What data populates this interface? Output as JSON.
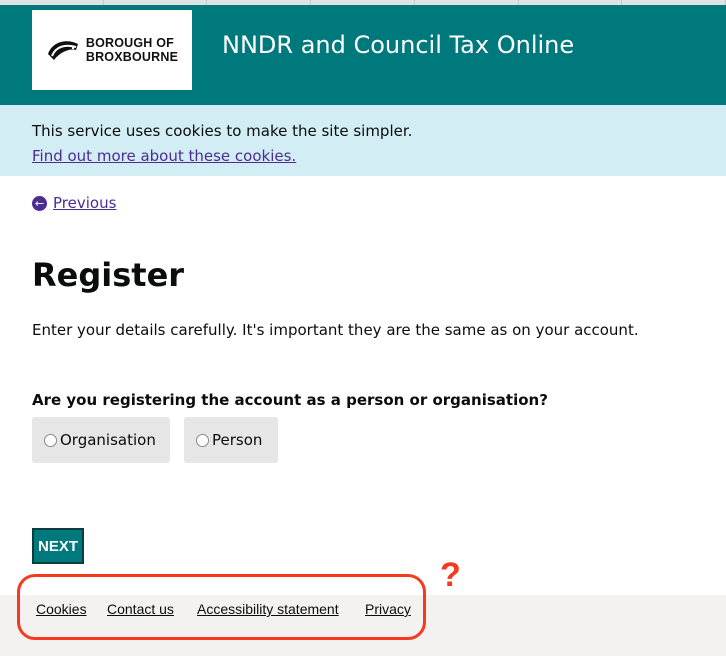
{
  "logo": {
    "line1": "BOROUGH OF",
    "line2": "BROXBOURNE"
  },
  "header": {
    "service_name": "NNDR and Council Tax Online"
  },
  "cookie_banner": {
    "text": "This service uses cookies to make the site simpler.",
    "link": "Find out more about these cookies."
  },
  "nav": {
    "back_label": "Previous"
  },
  "main": {
    "title": "Register",
    "intro": "Enter your details carefully. It's important they are the same as on your account.",
    "question": "Are you registering the account as a person or organisation?",
    "options": [
      "Organisation",
      "Person"
    ],
    "next_label": "NEXT"
  },
  "footer": {
    "links": [
      "Cookies",
      "Contact us",
      "Accessibility statement",
      "Privacy"
    ]
  },
  "annotation": {
    "mark": "?",
    "color": "#f53a1f"
  },
  "colors": {
    "brand_teal": "#00797c",
    "banner_blue": "#d2edf4",
    "link_purple": "#4c2c92"
  }
}
